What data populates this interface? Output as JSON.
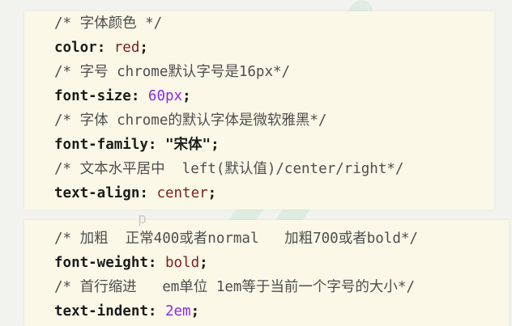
{
  "top_snippet": {
    "lines": [
      {
        "kind": "comment",
        "text": "/* 字体颜色 */"
      },
      {
        "kind": "decl",
        "prop": "color",
        "value": "red",
        "value_style": "kw"
      },
      {
        "kind": "comment",
        "text": "/* 字号 chrome默认字号是16px*/"
      },
      {
        "kind": "decl",
        "prop": "font-size",
        "value": "60px",
        "value_style": "num"
      },
      {
        "kind": "comment",
        "text": "/* 字体 chrome的默认字体是微软雅黑*/"
      },
      {
        "kind": "decl",
        "prop": "font-family",
        "value": "\"宋体\"",
        "value_style": "str"
      },
      {
        "kind": "comment",
        "text": "/* 文本水平居中  left(默认值)/center/right*/"
      },
      {
        "kind": "decl",
        "prop": "text-align",
        "value": "center",
        "value_style": "kw"
      }
    ]
  },
  "bottom_snippet": {
    "clipped_glyph": "p",
    "lines": [
      {
        "kind": "comment",
        "text": "/* 加粗  正常400或者normal   加粗700或者bold*/"
      },
      {
        "kind": "decl",
        "prop": "font-weight",
        "value": "bold",
        "value_style": "kw"
      },
      {
        "kind": "comment",
        "text": "/* 首行缩进   em单位 1em等于当前一个字号的大小*/"
      },
      {
        "kind": "decl",
        "prop": "text-indent",
        "value": "2em",
        "value_style": "num"
      }
    ]
  },
  "colors": {
    "comment": "#4d4d4d",
    "property": "#1c1c1c",
    "keyword_value": "#7a1e1e",
    "number_value": "#8a2be2",
    "panel_bg": "#fbf8e8",
    "page_bg": "#f2f3ef"
  }
}
